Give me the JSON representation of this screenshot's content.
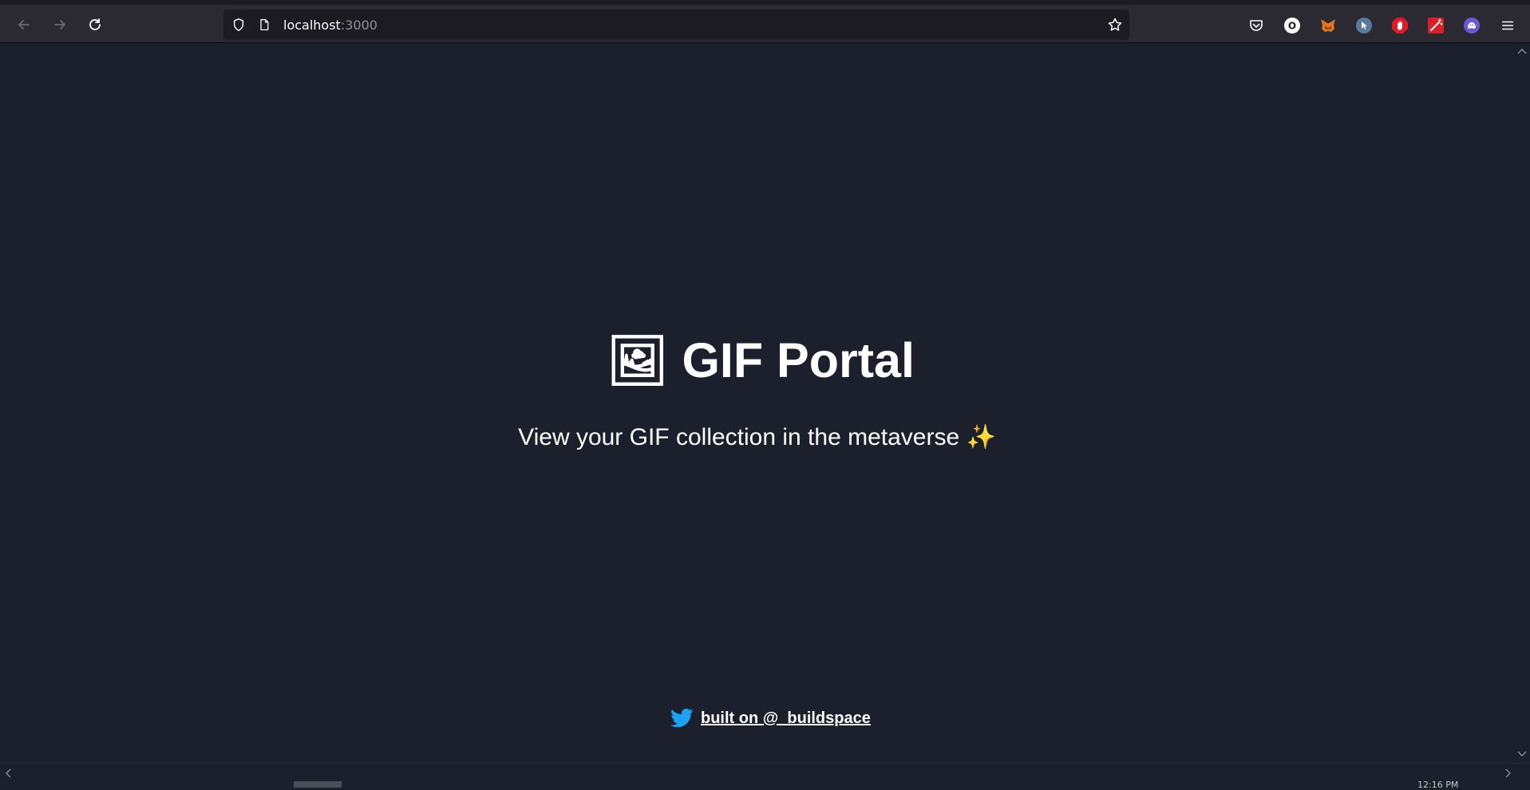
{
  "browser": {
    "url_host": "localhost",
    "url_port": ":3000",
    "icons": {
      "back": "arrow-left-icon",
      "forward": "arrow-right-icon",
      "reload": "reload-icon",
      "tracking": "shield-icon",
      "page": "page-icon",
      "bookmark": "star-icon",
      "pocket": "pocket-icon",
      "menu": "hamburger-menu-icon"
    },
    "extensions": [
      {
        "name": "ext-o-icon",
        "label": "O",
        "color": "#ffffff"
      },
      {
        "name": "metamask-fox-icon",
        "label": "",
        "color": "#e2761b"
      },
      {
        "name": "cursor-ext-icon",
        "label": "",
        "color": "#5a7a9c"
      },
      {
        "name": "adblock-hand-icon",
        "label": "",
        "color": "#e01b24"
      },
      {
        "name": "magic-wand-ext-icon",
        "label": "",
        "color": "#d91f26"
      },
      {
        "name": "ghost-ext-icon",
        "label": "",
        "color": "#6c57d8"
      }
    ]
  },
  "page": {
    "title_emoji": "🖼",
    "title": "GIF Portal",
    "subtitle": "View your GIF collection in the metaverse",
    "subtitle_emoji": "✨",
    "footer_link": "built on @_buildspace",
    "footer_icon": "twitter-icon",
    "colors": {
      "background": "#1b202c",
      "text": "#ffffff",
      "twitter": "#1da1f2"
    }
  },
  "status": {
    "time_partial": "12:16 PM"
  }
}
